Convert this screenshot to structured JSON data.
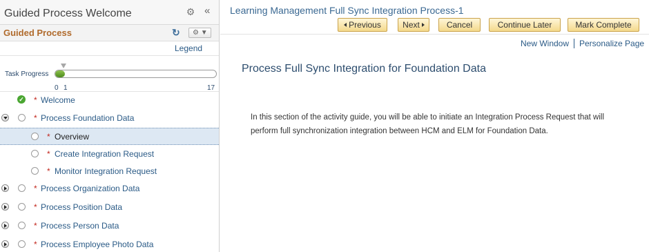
{
  "sidebar": {
    "title": "Guided Process Welcome",
    "guided_process_label": "Guided Process",
    "legend_label": "Legend",
    "task_progress_label": "Task Progress",
    "progress": {
      "min_label": "0",
      "current_label": "1",
      "max_label": "17",
      "current": 1,
      "max": 17
    },
    "steps": [
      {
        "label": "Welcome",
        "required": true,
        "status": "complete"
      },
      {
        "label": "Process Foundation Data",
        "required": true,
        "status": "expanded"
      },
      {
        "label": "Overview",
        "required": true,
        "status": "selected"
      },
      {
        "label": "Create Integration Request",
        "required": true,
        "status": "pending"
      },
      {
        "label": "Monitor Integration Request",
        "required": true,
        "status": "pending"
      },
      {
        "label": "Process Organization Data",
        "required": true,
        "status": "collapsed"
      },
      {
        "label": "Process Position Data",
        "required": true,
        "status": "collapsed"
      },
      {
        "label": "Process Person Data",
        "required": true,
        "status": "collapsed"
      },
      {
        "label": "Process Employee Photo Data",
        "required": true,
        "status": "collapsed"
      }
    ],
    "required_marker": "*"
  },
  "main": {
    "title": "Learning Management Full Sync Integration Process-1",
    "buttons": {
      "previous": "Previous",
      "next": "Next",
      "cancel": "Cancel",
      "continue_later": "Continue Later",
      "mark_complete": "Mark Complete"
    },
    "links": {
      "new_window": "New Window",
      "personalize_page": "Personalize Page"
    },
    "heading": "Process Full Sync Integration for Foundation Data",
    "body_text": "In this section of the activity guide, you will be able to initiate an Integration Process Request that will perform full synchronization integration between HCM and ELM for Foundation Data."
  },
  "colors": {
    "accent_orange": "#b06a2b",
    "link_blue": "#2a5a86",
    "progress_green": "#4c8a1d",
    "required_red": "#c2271e",
    "button_gold": "#f4d98c"
  },
  "icons": {
    "settings": "gear-icon",
    "collapse": "double-chevron-left-icon",
    "refresh": "refresh-icon",
    "actions_menu": "gear-dropdown-icon",
    "complete": "checkmark-icon",
    "pending": "circle-icon",
    "expand": "expand-arrow-icon"
  }
}
